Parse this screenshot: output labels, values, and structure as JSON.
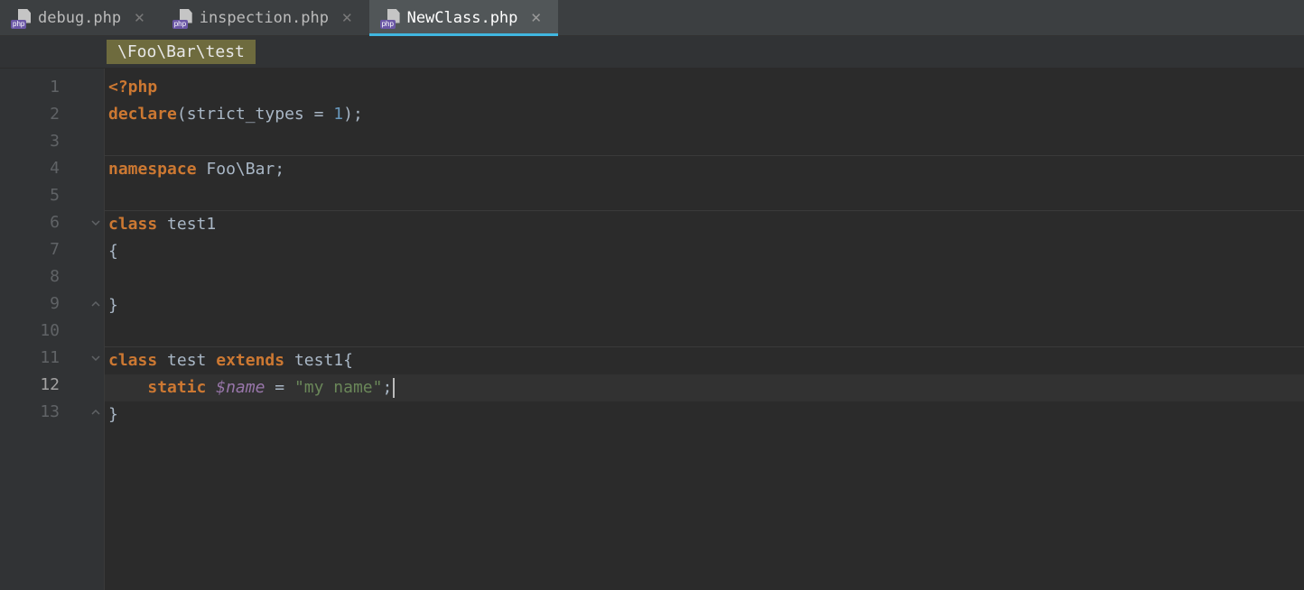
{
  "tabs": [
    {
      "label": "debug.php",
      "icon_badge": "php",
      "active": false
    },
    {
      "label": "inspection.php",
      "icon_badge": "php",
      "active": false
    },
    {
      "label": "NewClass.php",
      "icon_badge": "php",
      "active": true
    }
  ],
  "breadcrumb": "\\Foo\\Bar\\test",
  "line_numbers": [
    "1",
    "2",
    "3",
    "4",
    "5",
    "6",
    "7",
    "8",
    "9",
    "10",
    "11",
    "12",
    "13"
  ],
  "current_line": 12,
  "code": {
    "l1": {
      "open_tag": "<?php"
    },
    "l2": {
      "kw": "declare",
      "lp": "(",
      "param": "strict_types",
      "eq": " = ",
      "val": "1",
      "rp": ")",
      "sc": ";"
    },
    "l4": {
      "kw": "namespace",
      "sp": " ",
      "ns": "Foo\\Bar",
      "sc": ";"
    },
    "l6": {
      "kw": "class",
      "sp": " ",
      "name": "test1"
    },
    "l7": {
      "brace": "{"
    },
    "l9": {
      "brace": "}"
    },
    "l11": {
      "kw1": "class",
      "sp1": " ",
      "name": "test",
      "sp2": " ",
      "kw2": "extends",
      "sp3": " ",
      "base": "test1",
      "brace": "{"
    },
    "l12": {
      "indent": "    ",
      "kw": "static",
      "sp": " ",
      "var": "$name",
      "eq": " = ",
      "str": "\"my name\"",
      "sc": ";"
    },
    "l13": {
      "brace": "}"
    }
  }
}
